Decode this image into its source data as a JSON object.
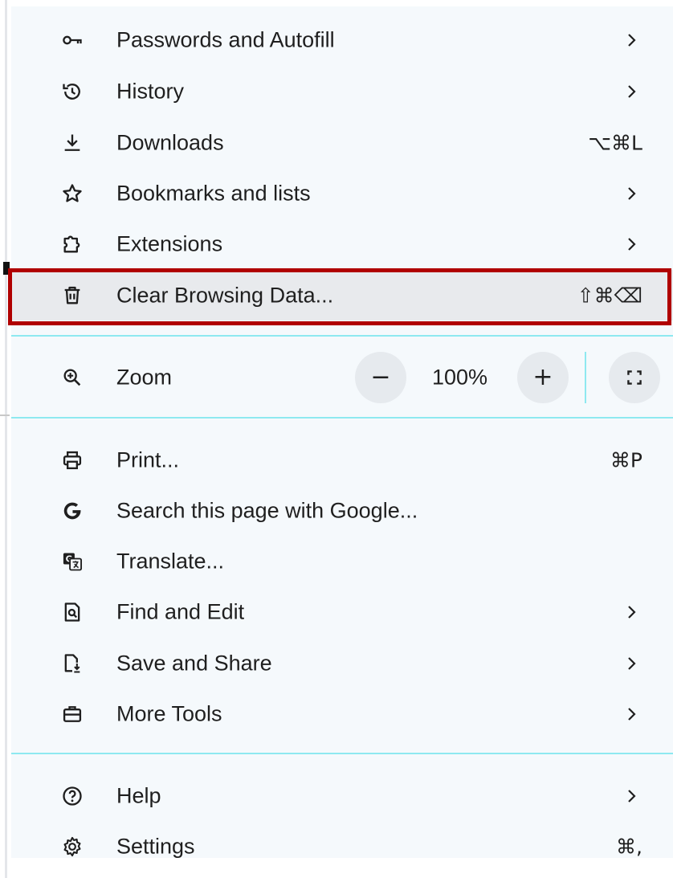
{
  "menu": {
    "items_top": [
      {
        "name": "passwords-and-autofill",
        "label": "Passwords and Autofill",
        "shortcut": "",
        "has_submenu": true,
        "icon": "key-icon"
      },
      {
        "name": "history",
        "label": "History",
        "shortcut": "",
        "has_submenu": true,
        "icon": "history-icon"
      },
      {
        "name": "downloads",
        "label": "Downloads",
        "shortcut": "⌥⌘L",
        "has_submenu": false,
        "icon": "download-icon"
      },
      {
        "name": "bookmarks-and-lists",
        "label": "Bookmarks and lists",
        "shortcut": "",
        "has_submenu": true,
        "icon": "star-icon"
      },
      {
        "name": "extensions",
        "label": "Extensions",
        "shortcut": "",
        "has_submenu": true,
        "icon": "puzzle-icon"
      },
      {
        "name": "clear-browsing-data",
        "label": "Clear Browsing Data...",
        "shortcut": "⇧⌘⌫",
        "has_submenu": false,
        "icon": "trash-icon",
        "highlighted": true
      }
    ],
    "zoom": {
      "label": "Zoom",
      "value": "100%",
      "minus": "−",
      "plus": "+",
      "icon": "zoom-icon",
      "fullscreen_icon": "fullscreen-icon"
    },
    "items_mid": [
      {
        "name": "print",
        "label": "Print...",
        "shortcut": "⌘P",
        "has_submenu": false,
        "icon": "printer-icon"
      },
      {
        "name": "search-with-google",
        "label": "Search this page with Google...",
        "shortcut": "",
        "has_submenu": false,
        "icon": "google-icon"
      },
      {
        "name": "translate",
        "label": "Translate...",
        "shortcut": "",
        "has_submenu": false,
        "icon": "translate-icon"
      },
      {
        "name": "find-and-edit",
        "label": "Find and Edit",
        "shortcut": "",
        "has_submenu": true,
        "icon": "find-in-page-icon"
      },
      {
        "name": "save-and-share",
        "label": "Save and Share",
        "shortcut": "",
        "has_submenu": true,
        "icon": "save-page-icon"
      },
      {
        "name": "more-tools",
        "label": "More Tools",
        "shortcut": "",
        "has_submenu": true,
        "icon": "toolbox-icon"
      }
    ],
    "items_bottom": [
      {
        "name": "help",
        "label": "Help",
        "shortcut": "",
        "has_submenu": true,
        "icon": "help-icon"
      },
      {
        "name": "settings",
        "label": "Settings",
        "shortcut": "⌘,",
        "has_submenu": false,
        "icon": "settings-icon"
      }
    ]
  },
  "colors": {
    "menu_bg": "#f5f9fc",
    "highlight_bg": "#e8eaed",
    "highlight_border": "#b00000",
    "separator": "#8ee9f0",
    "text": "#1f1f1f"
  }
}
